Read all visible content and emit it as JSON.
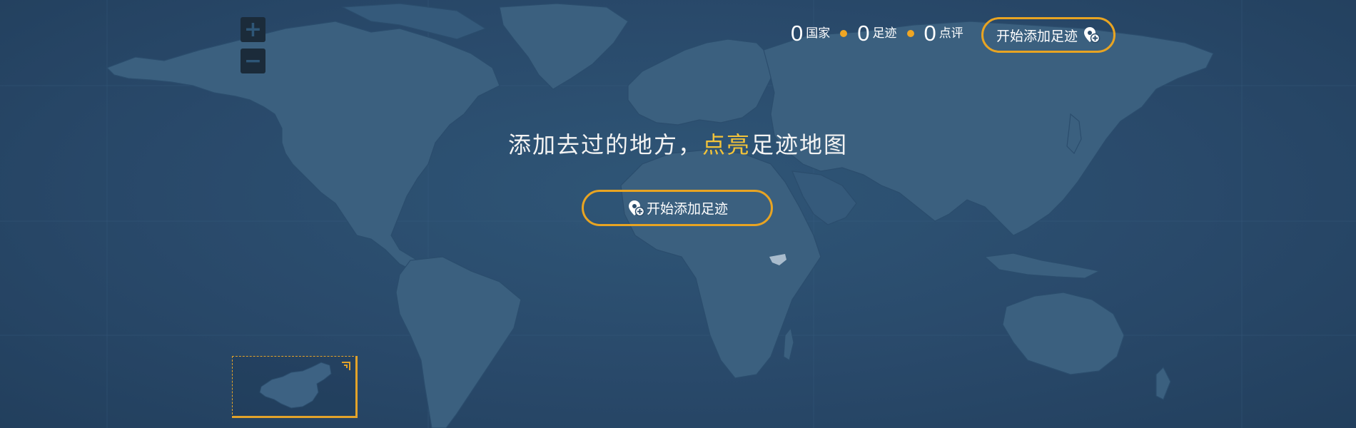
{
  "zoom": {
    "in_label": "+",
    "out_label": "−"
  },
  "stats": [
    {
      "value": "0",
      "label": "国家"
    },
    {
      "value": "0",
      "label": "足迹"
    },
    {
      "value": "0",
      "label": "点评"
    }
  ],
  "top_button": {
    "label": "开始添加足迹",
    "icon": "map-pin-add-icon"
  },
  "headline": {
    "part1": "添加去过的地方，",
    "highlight": "点亮",
    "part2": "足迹地图"
  },
  "center_button": {
    "label": "开始添加足迹",
    "icon": "map-pin-add-icon"
  },
  "minimap": {
    "toggle_icon": "corner-arrow-icon"
  },
  "colors": {
    "background": "#2a4c6b",
    "accent": "#e8a422",
    "highlight_text": "#f2c33a"
  }
}
